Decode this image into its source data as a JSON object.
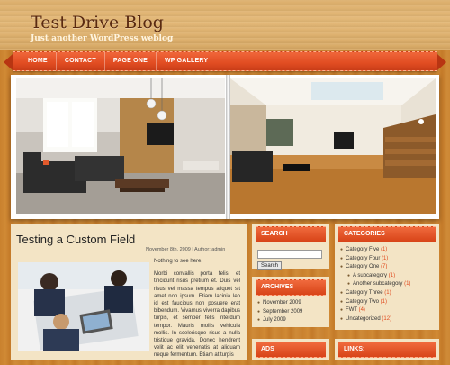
{
  "site": {
    "title": "Test Drive Blog",
    "tagline": "Just another WordPress weblog"
  },
  "nav": [
    "HOME",
    "CONTACT",
    "PAGE ONE",
    "WP GALLERY"
  ],
  "post": {
    "title": "Testing a Custom Field",
    "date": "November 8th, 2009",
    "author_label": "Author:",
    "author": "admin",
    "intro": "Nothing to see here.",
    "body": "Morbi convallis porta felis, et tincidunt risus pretium et. Duis vel risus vel massa tempus aliquet sit amet non ipsum. Etiam lacinia leo id est faucibus non posuere erat bibendum. Vivamus viverra dapibus turpis, et semper felis interdum tempor. Mauris mollis vehicula mollis. In scelerisque risus a nulla tristique gravida. Donec hendrerit velit ac elit venenatis at aliquam neque fermentum. Etiam at turpis"
  },
  "search": {
    "title": "SEARCH",
    "button": "Search"
  },
  "archives": {
    "title": "ARCHIVES",
    "items": [
      "November 2009",
      "September 2009",
      "July 2009"
    ]
  },
  "ads": {
    "title": "ADS"
  },
  "categories": {
    "title": "CATEGORIES",
    "items": [
      {
        "name": "Category Five",
        "count": "(1)",
        "sub": false
      },
      {
        "name": "Category Four",
        "count": "(1)",
        "sub": false
      },
      {
        "name": "Category One",
        "count": "(7)",
        "sub": false
      },
      {
        "name": "A subcategory",
        "count": "(1)",
        "sub": true
      },
      {
        "name": "Another subcategory",
        "count": "(1)",
        "sub": true
      },
      {
        "name": "Category Three",
        "count": "(1)",
        "sub": false
      },
      {
        "name": "Category Two",
        "count": "(1)",
        "sub": false
      },
      {
        "name": "FWT",
        "count": "(4)",
        "sub": false
      },
      {
        "name": "Uncategorized",
        "count": "(12)",
        "sub": false
      }
    ]
  },
  "links": {
    "title": "LINKS:"
  }
}
